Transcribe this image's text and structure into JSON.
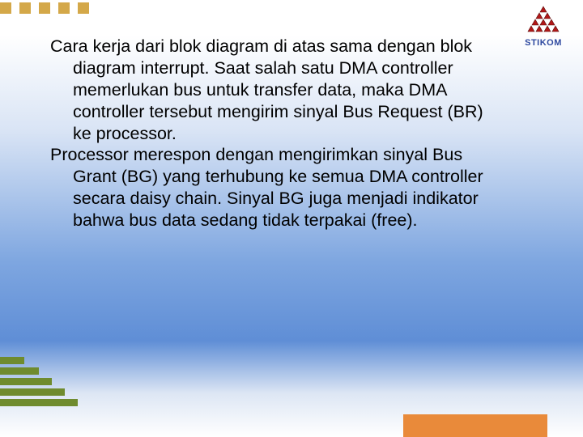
{
  "logo": {
    "label": "STIKOM"
  },
  "decor": {
    "top_square_color": "#d4a849",
    "green_bar_color": "#6f8b2e",
    "orange_block_color": "#e98a3a"
  },
  "content": {
    "paragraphs": [
      "Cara kerja dari blok diagram di atas sama dengan blok diagram interrupt. Saat salah satu DMA controller memerlukan bus untuk transfer data, maka DMA controller tersebut mengirim sinyal Bus Request (BR) ke processor.",
      "Processor merespon dengan mengirimkan sinyal Bus Grant (BG) yang terhubung ke semua DMA controller secara daisy chain. Sinyal BG juga menjadi indikator bahwa bus data sedang tidak terpakai (free)."
    ]
  }
}
